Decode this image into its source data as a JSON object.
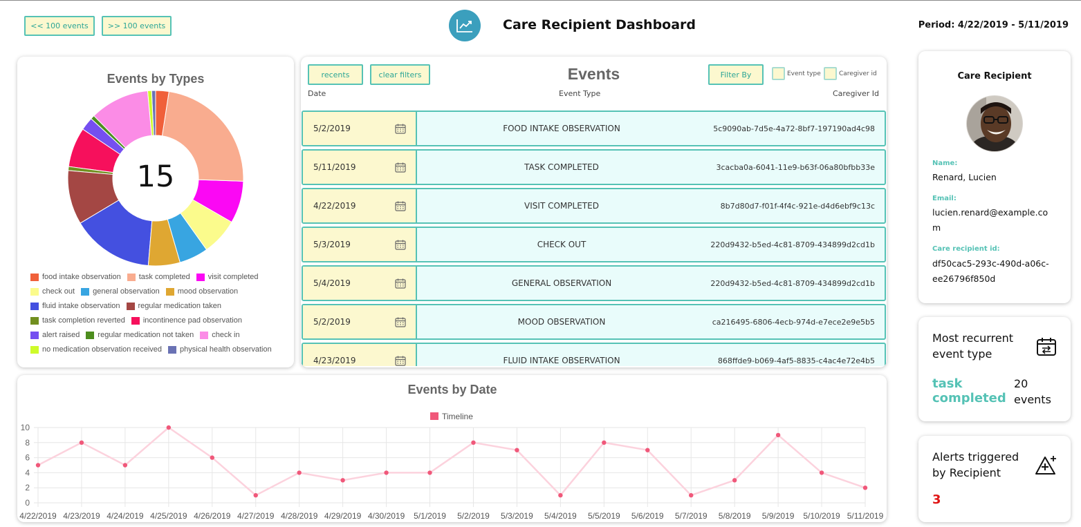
{
  "header": {
    "prev_label": "<< 100 events",
    "next_label": ">> 100 events",
    "title": "Care Recipient Dashboard",
    "period": "Period: 4/22/2019 - 5/11/2019"
  },
  "types_card": {
    "title": "Events by Types",
    "total": "15",
    "legend": [
      {
        "label": "food intake observation",
        "color": "#f0603a"
      },
      {
        "label": "task completed",
        "color": "#f9ac8f"
      },
      {
        "label": "visit completed",
        "color": "#fb08f4"
      },
      {
        "label": "check out",
        "color": "#fbfb8c"
      },
      {
        "label": "general observation",
        "color": "#38a5e1"
      },
      {
        "label": "mood observation",
        "color": "#dfa732"
      },
      {
        "label": "fluid intake observation",
        "color": "#4450e0"
      },
      {
        "label": "regular medication taken",
        "color": "#a44744"
      },
      {
        "label": "task completion reverted",
        "color": "#718f1f"
      },
      {
        "label": "incontinence pad observation",
        "color": "#f6105c"
      },
      {
        "label": "alert raised",
        "color": "#754ff0"
      },
      {
        "label": "regular medication not taken",
        "color": "#4d8d1e"
      },
      {
        "label": "check in",
        "color": "#fb8ce6"
      },
      {
        "label": "no medication observation received",
        "color": "#cefb2a"
      },
      {
        "label": "physical health observation",
        "color": "#6a72b4"
      }
    ],
    "slices": [
      1,
      9.5,
      3.2,
      2.8,
      2.2,
      2.4,
      6.2,
      4.1,
      0.3,
      3,
      1,
      0.3,
      4.5,
      0.3,
      0.3
    ]
  },
  "events_card": {
    "recents_label": "recents",
    "clear_label": "clear filters",
    "title": "Events",
    "filter_label": "Filter By",
    "check_event_type": "Event type",
    "check_caregiver": "Caregiver id",
    "col_date": "Date",
    "col_type": "Event Type",
    "col_caregiver": "Caregiver Id",
    "rows": [
      {
        "date": "5/2/2019",
        "type": "FOOD INTAKE OBSERVATION",
        "caregiver": "5c9090ab-7d5e-4a72-8bf7-197190ad4c98"
      },
      {
        "date": "5/11/2019",
        "type": "TASK COMPLETED",
        "caregiver": "3cacba0a-6041-11e9-b63f-06a80bfbb33e"
      },
      {
        "date": "4/22/2019",
        "type": "VISIT COMPLETED",
        "caregiver": "8b7d80d7-f01f-4f4c-921e-d4d6ebf9c13c"
      },
      {
        "date": "5/3/2019",
        "type": "CHECK OUT",
        "caregiver": "220d9432-b5ed-4c81-8709-434899d2cd1b"
      },
      {
        "date": "5/4/2019",
        "type": "GENERAL OBSERVATION",
        "caregiver": "220d9432-b5ed-4c81-8709-434899d2cd1b"
      },
      {
        "date": "5/2/2019",
        "type": "MOOD OBSERVATION",
        "caregiver": "ca216495-6806-4ecb-974d-e7ece2e9e5b5"
      },
      {
        "date": "4/23/2019",
        "type": "FLUID INTAKE OBSERVATION",
        "caregiver": "868ffde9-b069-4af5-8835-c4ac4e72e4b5"
      }
    ]
  },
  "recipient": {
    "title": "Care Recipient",
    "name_label": "Name:",
    "name": "Renard, Lucien",
    "email_label": "Email:",
    "email_line1": "lucien.renard@example.co",
    "email_line2": "m",
    "id_label": "Care recipient id:",
    "id_line1": "df50cac5-293c-490d-a06c-",
    "id_line2": "ee26796f850d"
  },
  "recurrent": {
    "title_line1": "Most recurrent",
    "title_line2": "event type",
    "type_line1": "task",
    "type_line2": "completed",
    "count_line1": "20",
    "count_line2": "events"
  },
  "alerts": {
    "title_line1": "Alerts triggered",
    "title_line2": "by Recipient",
    "count": "3"
  },
  "chart_data": {
    "type": "line",
    "title": "Events by Date",
    "xlabel": "",
    "ylabel": "",
    "ylim": [
      0,
      10
    ],
    "yticks": [
      "0",
      "2",
      "4",
      "6",
      "8",
      "10"
    ],
    "grid": true,
    "legend_position": "top-center",
    "categories": [
      "4/22/2019",
      "4/23/2019",
      "4/24/2019",
      "4/25/2019",
      "4/26/2019",
      "4/27/2019",
      "4/28/2019",
      "4/29/2019",
      "4/30/2019",
      "5/1/2019",
      "5/2/2019",
      "5/3/2019",
      "5/4/2019",
      "5/5/2019",
      "5/6/2019",
      "5/7/2019",
      "5/8/2019",
      "5/9/2019",
      "5/10/2019",
      "5/11/2019"
    ],
    "series": [
      {
        "name": "Timeline",
        "values": [
          5,
          8,
          5,
          10,
          6,
          1,
          4,
          3,
          4,
          4,
          8,
          7,
          1,
          8,
          7,
          1,
          3,
          9,
          4,
          2
        ],
        "color": "#f0587a",
        "line_color": "#fcd2dd"
      }
    ]
  },
  "colors": {
    "accent": "#55c2b5",
    "button_fill": "#fcf8cf",
    "row_fill": "#e9fcfb",
    "alert": "#e01515"
  }
}
